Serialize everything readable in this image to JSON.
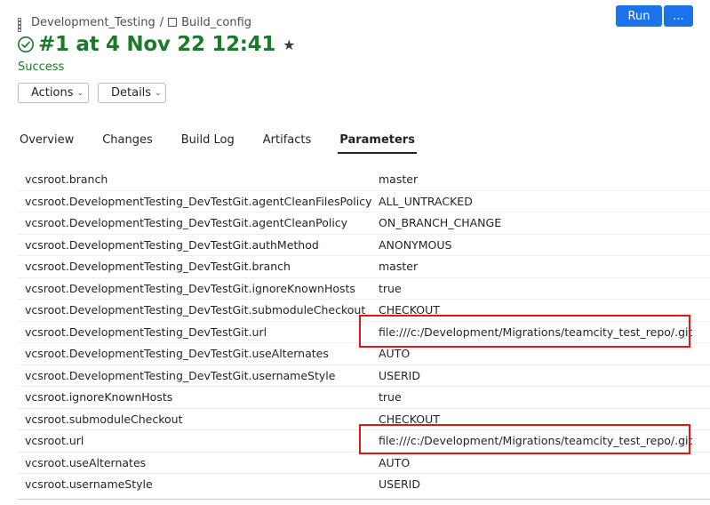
{
  "breadcrumb": {
    "project": "Development_Testing",
    "separator": "/",
    "config": "Build_config"
  },
  "build": {
    "title": "#1 at 4 Nov 22 12:41",
    "status": "Success"
  },
  "buttons": {
    "actions": "Actions",
    "details": "Details",
    "run": "Run",
    "more": "..."
  },
  "tabs": [
    "Overview",
    "Changes",
    "Build Log",
    "Artifacts",
    "Parameters"
  ],
  "active_tab": "Parameters",
  "parameters": [
    {
      "name": "vcsroot.branch",
      "value": "master"
    },
    {
      "name": "vcsroot.DevelopmentTesting_DevTestGit.agentCleanFilesPolicy",
      "value": "ALL_UNTRACKED"
    },
    {
      "name": "vcsroot.DevelopmentTesting_DevTestGit.agentCleanPolicy",
      "value": "ON_BRANCH_CHANGE"
    },
    {
      "name": "vcsroot.DevelopmentTesting_DevTestGit.authMethod",
      "value": "ANONYMOUS"
    },
    {
      "name": "vcsroot.DevelopmentTesting_DevTestGit.branch",
      "value": "master"
    },
    {
      "name": "vcsroot.DevelopmentTesting_DevTestGit.ignoreKnownHosts",
      "value": "true"
    },
    {
      "name": "vcsroot.DevelopmentTesting_DevTestGit.submoduleCheckout",
      "value": "CHECKOUT"
    },
    {
      "name": "vcsroot.DevelopmentTesting_DevTestGit.url",
      "value": "file:///c:/Development/Migrations/teamcity_test_repo/.git"
    },
    {
      "name": "vcsroot.DevelopmentTesting_DevTestGit.useAlternates",
      "value": "AUTO"
    },
    {
      "name": "vcsroot.DevelopmentTesting_DevTestGit.usernameStyle",
      "value": "USERID"
    },
    {
      "name": "vcsroot.ignoreKnownHosts",
      "value": "true"
    },
    {
      "name": "vcsroot.submoduleCheckout",
      "value": "CHECKOUT"
    },
    {
      "name": "vcsroot.url",
      "value": "file:///c:/Development/Migrations/teamcity_test_repo/.git"
    },
    {
      "name": "vcsroot.useAlternates",
      "value": "AUTO"
    },
    {
      "name": "vcsroot.usernameStyle",
      "value": "USERID"
    }
  ],
  "colors": {
    "success": "#1b7a2a",
    "primary_button": "#1a73e8",
    "highlight_box": "#e0161b"
  },
  "icons": {
    "project": "grid-icon",
    "config": "square-icon",
    "status": "check-circle-icon",
    "favorite": "star-icon",
    "dropdown": "chevron-down-icon"
  }
}
